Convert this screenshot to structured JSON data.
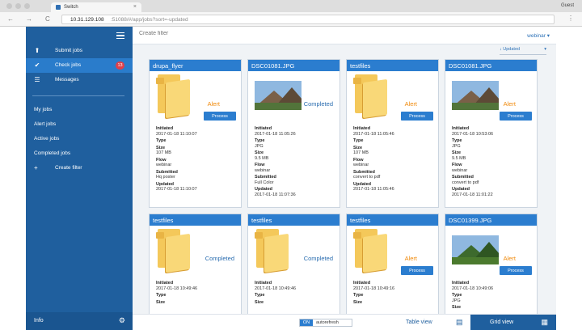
{
  "browser": {
    "tab_title": "Switch",
    "tab_close": "×",
    "profile": "Guest",
    "url_host": "10.31.129.108",
    "url_path": ":51088/#/app/jobs?sort=-updated",
    "back": "←",
    "forward": "→",
    "reload": "C",
    "menu": "⋮"
  },
  "sidebar": {
    "items": [
      {
        "label": "Submit jobs",
        "icon": "upload-icon",
        "glyph": "⬆"
      },
      {
        "label": "Check jobs",
        "icon": "check-circle-icon",
        "glyph": "✔",
        "badge": "13"
      },
      {
        "label": "Messages",
        "icon": "messages-icon",
        "glyph": "☰"
      }
    ],
    "links": [
      "My jobs",
      "Alert jobs",
      "Active jobs",
      "Completed jobs"
    ],
    "create_filter": "Create filter",
    "plus_glyph": "+",
    "footer_label": "Info",
    "gear_glyph": "⚙"
  },
  "main": {
    "filter_placeholder": "Create filter",
    "account": "webinar ▾",
    "sort_label": "↓ Updated",
    "sort_caret": "▾"
  },
  "cards": [
    {
      "title": "drupa_flyer",
      "thumb": "folder",
      "status": "Alert",
      "process": "Process",
      "fields": [
        [
          "Initiated",
          "2017-01-18 11:10:07"
        ],
        [
          "Type",
          ""
        ],
        [
          "Size",
          "107 MB"
        ],
        [
          "Flow",
          "webinar"
        ],
        [
          "Submitted",
          "Hq poster"
        ],
        [
          "Updated",
          "2017-01-18 11:10:07"
        ]
      ]
    },
    {
      "title": "DSC01081.JPG",
      "thumb": "photo",
      "status": "Completed",
      "fields": [
        [
          "Initiated",
          "2017-01-18 11:05:26"
        ],
        [
          "Type",
          "JPG"
        ],
        [
          "Size",
          "9.5 MB"
        ],
        [
          "Flow",
          "webinar"
        ],
        [
          "Submitted",
          "Full Color"
        ],
        [
          "Updated",
          "2017-01-18 11:07:36"
        ]
      ]
    },
    {
      "title": "testfiles",
      "thumb": "folder",
      "status": "Alert",
      "process": "Process",
      "fields": [
        [
          "Initiated",
          "2017-01-18 11:05:46"
        ],
        [
          "Type",
          ""
        ],
        [
          "Size",
          "107 MB"
        ],
        [
          "Flow",
          "webinar"
        ],
        [
          "Submitted",
          "convert to pdf"
        ],
        [
          "Updated",
          "2017-01-18 11:05:46"
        ]
      ]
    },
    {
      "title": "DSC01081.JPG",
      "thumb": "photo",
      "status": "Alert",
      "process": "Process",
      "fields": [
        [
          "Initiated",
          "2017-01-18 10:53:06"
        ],
        [
          "Type",
          "JPG"
        ],
        [
          "Size",
          "9.5 MB"
        ],
        [
          "Flow",
          "webinar"
        ],
        [
          "Submitted",
          "convert to pdf"
        ],
        [
          "Updated",
          "2017-01-18 11:01:22"
        ]
      ]
    },
    {
      "title": "testfiles",
      "thumb": "folder",
      "status": "Completed",
      "fields": [
        [
          "Initiated",
          "2017-01-18 10:49:46"
        ],
        [
          "Type",
          ""
        ],
        [
          "Size",
          ""
        ]
      ]
    },
    {
      "title": "testfiles",
      "thumb": "folder",
      "status": "Completed",
      "fields": [
        [
          "Initiated",
          "2017-01-18 10:49:46"
        ],
        [
          "Type",
          ""
        ],
        [
          "Size",
          ""
        ]
      ]
    },
    {
      "title": "testfiles",
      "thumb": "folder",
      "status": "Alert",
      "process": "Process",
      "fields": [
        [
          "Initiated",
          "2017-01-18 10:49:16"
        ],
        [
          "Type",
          ""
        ],
        [
          "Size",
          ""
        ]
      ]
    },
    {
      "title": "DSC01399.JPG",
      "thumb": "photo-green",
      "status": "Alert",
      "process": "Process",
      "fields": [
        [
          "Initiated",
          "2017-01-18 10:49:06"
        ],
        [
          "Type",
          "JPG"
        ],
        [
          "Size",
          ""
        ]
      ]
    }
  ],
  "bottom": {
    "on_label": "ON",
    "autorefresh": "autorefresh",
    "table_view": "Table view",
    "table_glyph": "▤",
    "grid_view": "Grid view",
    "grid_glyph": "▦"
  },
  "colors": {
    "sidebar": "#1f5f9e",
    "accent": "#2b7dcf",
    "alert": "#f08a0c",
    "completed": "#2a6db0",
    "badge": "#e0404a"
  }
}
